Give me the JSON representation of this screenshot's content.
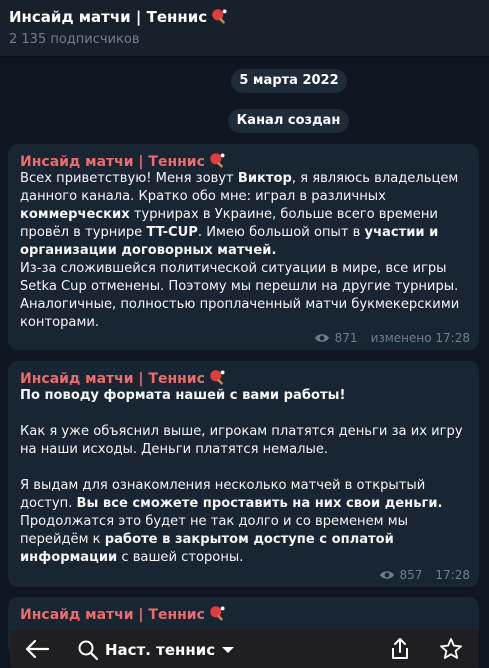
{
  "header": {
    "title": "Инсайд матчи | Теннис",
    "subscribers": "2 135 подписчиков"
  },
  "service": {
    "date": "5 марта 2022",
    "created": "Канал создан"
  },
  "messages": [
    {
      "author": "Инсайд матчи | Теннис",
      "views": "871",
      "time": "изменено 17:28",
      "p1": {
        "t1": "Всех приветствую! Меня зовут ",
        "b1": "Виктор",
        "t2": ", я являюсь владельцем данного канала. Кратко обо мне: играл в различных ",
        "b2": "коммерческих",
        "t3": " турнирах в Украине, больше всего времени провёл в турнире ",
        "b3": "TT-CUP",
        "t4": ". Имею большой опыт в ",
        "b4": "участии и организации договорных матчей."
      },
      "p2": "Из-за сложившейся политической ситуации в мире, все игры Setka Cup отменены. Поэтому мы перешли на другие турниры. Аналогичные, полностью проплаченный матчи  букмекерскими конторами."
    },
    {
      "author": "Инсайд матчи | Теннис",
      "views": "857",
      "time": "17:28",
      "heading": "По поводу формата нашей с вами работы!",
      "p1": "Как я уже объяснил выше, игрокам платятся деньги за их игру на наши исходы. Деньги платятся немалые.",
      "p2": {
        "t1": "Я выдам для ознакомления несколько матчей в открытый доступ. ",
        "b1": "Вы все сможете проставить на них свои деньги.",
        "t2": " Продолжатся это будет не так долго и со временем мы перейдём к ",
        "b2": "работе в закрытом доступе с оплатой информации",
        "t3": " с вашей стороны."
      }
    },
    {
      "author": "Инсайд матчи | Теннис"
    }
  ],
  "toolbar": {
    "dropdown_label": "Наст. теннис"
  },
  "colors": {
    "background": "#0e1621",
    "bubble": "#182533",
    "author": "#ef6b6b",
    "meta": "#6d7f8f"
  },
  "icons": [
    "ping-pong-icon",
    "eye-icon",
    "back-arrow-icon",
    "search-icon",
    "chevron-down-icon",
    "share-icon",
    "star-icon"
  ]
}
